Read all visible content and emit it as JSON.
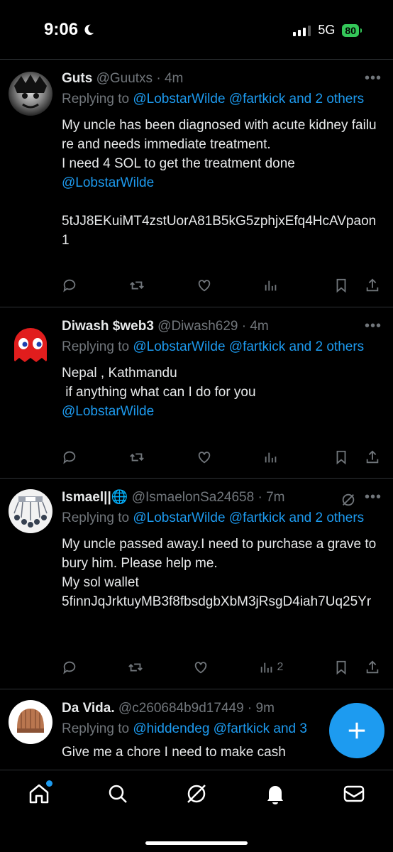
{
  "status_bar": {
    "time": "9:06",
    "network": "5G",
    "battery": "80"
  },
  "tweets": [
    {
      "name": "Guts",
      "handle": "@Guutxs",
      "time": "4m",
      "replying_prefix": "Replying to ",
      "replying_to": "@LobstarWilde @fartkick and 2 others",
      "body": "My uncle has been diagnosed with acute kidney failure and needs immediate treatment.\nI need 4 SOL to get the treatment done",
      "body_mention": "@LobstarWilde",
      "body_extra": "5tJJ8EKuiMT4zstUorA81B5kG5zphjxEfq4HcAVpaon1",
      "views": "",
      "more": "•••"
    },
    {
      "name": "Diwash $web3",
      "handle": "@Diwash629",
      "time": "4m",
      "replying_prefix": "Replying to ",
      "replying_to": "@LobstarWilde @fartkick and 2 others",
      "body": "Nepal , Kathmandu\n if anything what can I do for you",
      "body_mention": "@LobstarWilde",
      "views": "",
      "more": "•••"
    },
    {
      "name": "Ismael||🌐",
      "handle": "@IsmaelonSa24658",
      "time": "7m",
      "replying_prefix": "Replying to ",
      "replying_to": "@LobstarWilde @fartkick and 2 others",
      "body": "My uncle passed away.I need to purchase a grave to bury him. Please help me.\nMy sol wallet\n5finnJqJrktuyMB3f8fbsdgbXbM3jRsgD4iah7Uq25Yr",
      "views": "2",
      "more": "•••"
    },
    {
      "name": "Da Vida.",
      "handle": "@c260684b9d17449",
      "time": "9m",
      "replying_prefix": "Replying to ",
      "replying_to": "@hiddendeg @fartkick and 3",
      "body": "Give me a chore I need to make cash"
    }
  ],
  "colors": {
    "accent": "#1d9bf0",
    "muted": "#71767b",
    "text": "#e7e9ea",
    "battery": "#34c759"
  },
  "icons": [
    "reply-icon",
    "retweet-icon",
    "like-icon",
    "views-icon",
    "bookmark-icon",
    "share-icon",
    "home-icon",
    "search-icon",
    "grok-icon",
    "notifications-icon",
    "messages-icon",
    "compose-icon"
  ]
}
